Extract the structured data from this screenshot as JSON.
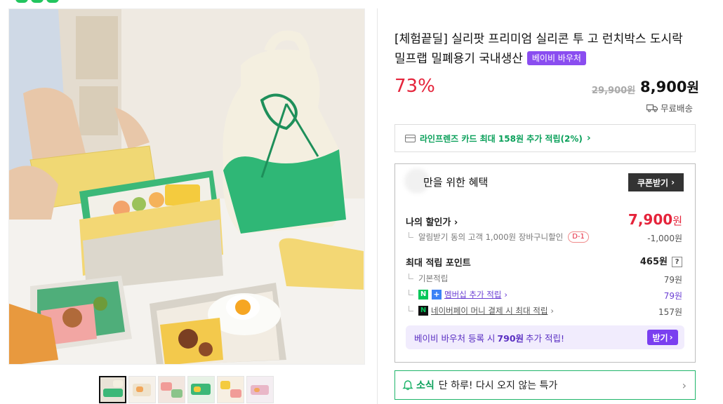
{
  "product": {
    "title": "[체험끝딜] 실리팟 프리미엄 실리콘 투 고 런치박스 도시락 밀프랩 밀폐용기 국내생산",
    "voucher_badge": "베이비 바우처",
    "discount_rate": "73%",
    "original_price": "29,900원",
    "sale_price": "8,900",
    "sale_price_unit": "원",
    "shipping": "무료배송"
  },
  "card_promo": {
    "text": "라인프렌즈 카드 최대 158원 추가 적립(2%)",
    "arrow": "›"
  },
  "benefits": {
    "heading": "고객님만을 위한 혜택",
    "heading_visible": "만을 위한 혜택",
    "coupon_button": "쿠폰받기",
    "coupon_arrow": "›",
    "my_discount_label": "나의 할인가",
    "my_discount_arrow": "›",
    "my_discount_price": "7,900",
    "my_discount_unit": "원",
    "alarm_discount_label": "알림받기 동의 고객 1,000원 장바구니할인",
    "alarm_discount_tag": "D-1",
    "alarm_discount_value": "-1,000원",
    "max_points_label": "최대 적립 포인트",
    "max_points_value": "465원",
    "help_mark": "?",
    "basic_points_label": "기본적립",
    "basic_points_value": "79원",
    "membership_label": "멤버십 추가 적립",
    "membership_value": "79원",
    "npay_label": "네이버페이 머니 결제 시 최대 적립",
    "npay_value": "157원",
    "link_arrow": "›",
    "voucher_banner_prefix": "베이비 바우처 등록 시",
    "voucher_banner_amount": "790원",
    "voucher_banner_suffix": "추가 적립!",
    "voucher_button": "받기"
  },
  "news": {
    "tag": "소식",
    "text": "단 하루! 다시 오지 않는 특가",
    "arrow": "›"
  },
  "colors": {
    "accent_red": "#e5243b",
    "naver_green": "#03c75a",
    "voucher_purple": "#7a3ff0"
  },
  "icons": [
    "truck-icon",
    "card-icon",
    "bell-icon",
    "chevron-right-icon",
    "question-icon"
  ]
}
